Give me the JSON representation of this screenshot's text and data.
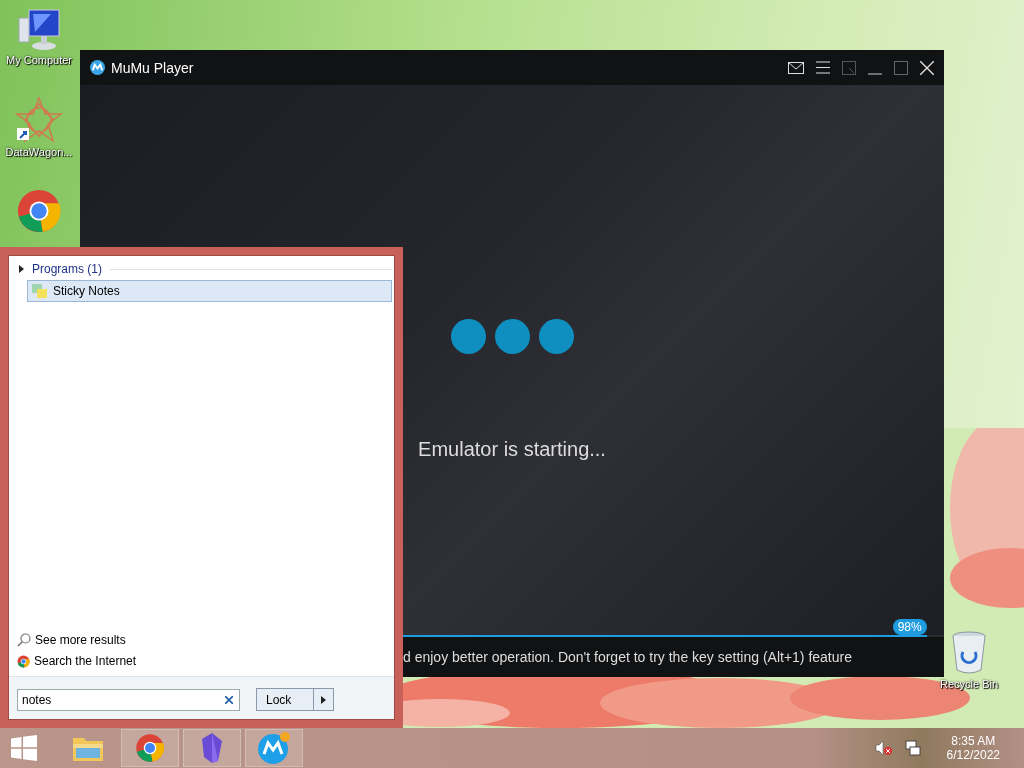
{
  "desktop_icons": [
    {
      "label": "My Computer",
      "kind": "computer"
    },
    {
      "label": "DataWagon...",
      "kind": "shortcut"
    },
    {
      "kind": "chrome"
    }
  ],
  "recycle_bin": {
    "label": "Recycle Bin"
  },
  "emulator_window": {
    "title": "MuMu Player",
    "status": "Emulator is starting...",
    "progress": {
      "level": 0.98,
      "reading": "98%"
    },
    "tip": "d enjoy better operation. Don't forget to try the key setting (Alt+1) feature"
  },
  "start_menu": {
    "group": {
      "label": "Programs (1)"
    },
    "results": [
      {
        "label": "Sticky Notes",
        "selected": true
      }
    ],
    "links": [
      {
        "label": "See more results",
        "kind": "search"
      },
      {
        "label": "Search the Internet",
        "kind": "chrome"
      }
    ],
    "search": {
      "value": "notes"
    },
    "power_button": {
      "label": "Lock"
    }
  },
  "taskbar": {
    "apps": [
      {
        "kind": "explorer"
      },
      {
        "kind": "chrome"
      },
      {
        "kind": "gem"
      },
      {
        "kind": "mumu"
      }
    ],
    "clock": {
      "time": "8:35 AM",
      "date": "6/12/2022"
    }
  }
}
